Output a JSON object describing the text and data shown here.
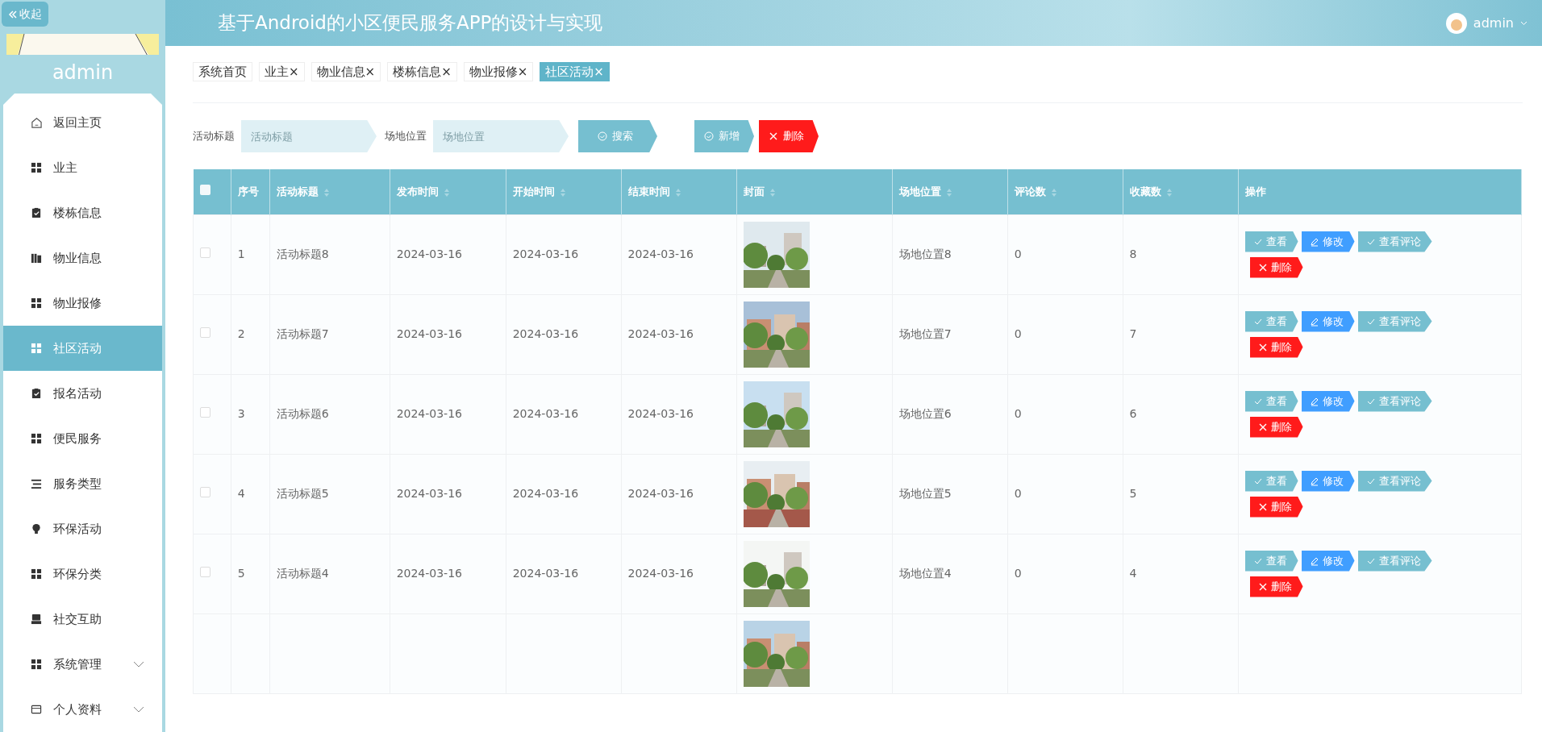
{
  "sidebar": {
    "collapse_button": "收起",
    "user": "admin",
    "items": [
      {
        "label": "返回主页",
        "selected": false,
        "expandable": false
      },
      {
        "label": "业主",
        "selected": false,
        "expandable": false
      },
      {
        "label": "楼栋信息",
        "selected": false,
        "expandable": false
      },
      {
        "label": "物业信息",
        "selected": false,
        "expandable": false
      },
      {
        "label": "物业报修",
        "selected": false,
        "expandable": false
      },
      {
        "label": "社区活动",
        "selected": true,
        "expandable": false
      },
      {
        "label": "报名活动",
        "selected": false,
        "expandable": false
      },
      {
        "label": "便民服务",
        "selected": false,
        "expandable": false
      },
      {
        "label": "服务类型",
        "selected": false,
        "expandable": false
      },
      {
        "label": "环保活动",
        "selected": false,
        "expandable": false
      },
      {
        "label": "环保分类",
        "selected": false,
        "expandable": false
      },
      {
        "label": "社交互助",
        "selected": false,
        "expandable": false
      },
      {
        "label": "系统管理",
        "selected": false,
        "expandable": true
      },
      {
        "label": "个人资料",
        "selected": false,
        "expandable": true
      }
    ]
  },
  "header": {
    "title": "基于Android的小区便民服务APP的设计与实现",
    "user": "admin"
  },
  "tabs": [
    {
      "label": "系统首页",
      "selected": false
    },
    {
      "label": "业主",
      "close": "×",
      "selected": false
    },
    {
      "label": "物业信息",
      "close": "×",
      "selected": false
    },
    {
      "label": "楼栋信息",
      "close": "×",
      "selected": false
    },
    {
      "label": "物业报修",
      "close": "×",
      "selected": false
    },
    {
      "label": "社区活动",
      "close": "×",
      "selected": true
    }
  ],
  "search": {
    "fields": [
      {
        "label": "活动标题",
        "placeholder": "活动标题"
      },
      {
        "label": "场地位置",
        "placeholder": "场地位置"
      }
    ],
    "buttons": [
      {
        "label": "搜索",
        "kind": "search"
      },
      {
        "label": "新增",
        "kind": "add"
      },
      {
        "label": "删除",
        "kind": "delete"
      }
    ]
  },
  "table": {
    "select_all": {
      "checked": false
    },
    "columns": [
      {
        "label": "序号",
        "sortable": false
      },
      {
        "label": "活动标题",
        "sortable": true
      },
      {
        "label": "发布时间",
        "sortable": true
      },
      {
        "label": "开始时间",
        "sortable": true
      },
      {
        "label": "结束时间",
        "sortable": true
      },
      {
        "label": "封面",
        "sortable": true
      },
      {
        "label": "场地位置",
        "sortable": true
      },
      {
        "label": "评论数",
        "sortable": true
      },
      {
        "label": "收藏数",
        "sortable": true
      },
      {
        "label": "操作",
        "sortable": false
      }
    ],
    "rows": [
      {
        "checked": false,
        "cells": [
          "1",
          "活动标题8",
          "2024-03-16",
          "2024-03-16",
          "2024-03-16",
          "",
          "场地位置8",
          "0",
          "8"
        ],
        "actions": [
          {
            "label": "查看",
            "kind": "view"
          },
          {
            "label": "修改",
            "kind": "edit"
          },
          {
            "label": "查看评论",
            "kind": "view"
          },
          {
            "label": "删除",
            "kind": "delete"
          }
        ]
      },
      {
        "checked": false,
        "cells": [
          "2",
          "活动标题7",
          "2024-03-16",
          "2024-03-16",
          "2024-03-16",
          "",
          "场地位置7",
          "0",
          "7"
        ],
        "actions": [
          {
            "label": "查看",
            "kind": "view"
          },
          {
            "label": "修改",
            "kind": "edit"
          },
          {
            "label": "查看评论",
            "kind": "view"
          },
          {
            "label": "删除",
            "kind": "delete"
          }
        ]
      },
      {
        "checked": false,
        "cells": [
          "3",
          "活动标题6",
          "2024-03-16",
          "2024-03-16",
          "2024-03-16",
          "",
          "场地位置6",
          "0",
          "6"
        ],
        "actions": [
          {
            "label": "查看",
            "kind": "view"
          },
          {
            "label": "修改",
            "kind": "edit"
          },
          {
            "label": "查看评论",
            "kind": "view"
          },
          {
            "label": "删除",
            "kind": "delete"
          }
        ]
      },
      {
        "checked": false,
        "cells": [
          "4",
          "活动标题5",
          "2024-03-16",
          "2024-03-16",
          "2024-03-16",
          "",
          "场地位置5",
          "0",
          "5"
        ],
        "actions": [
          {
            "label": "查看",
            "kind": "view"
          },
          {
            "label": "修改",
            "kind": "edit"
          },
          {
            "label": "查看评论",
            "kind": "view"
          },
          {
            "label": "删除",
            "kind": "delete"
          }
        ]
      },
      {
        "checked": false,
        "cells": [
          "5",
          "活动标题4",
          "2024-03-16",
          "2024-03-16",
          "2024-03-16",
          "",
          "场地位置4",
          "0",
          "4"
        ],
        "actions": [
          {
            "label": "查看",
            "kind": "view"
          },
          {
            "label": "修改",
            "kind": "edit"
          },
          {
            "label": "查看评论",
            "kind": "view"
          },
          {
            "label": "删除",
            "kind": "delete"
          }
        ]
      },
      {
        "kind": "picture_only"
      }
    ]
  }
}
